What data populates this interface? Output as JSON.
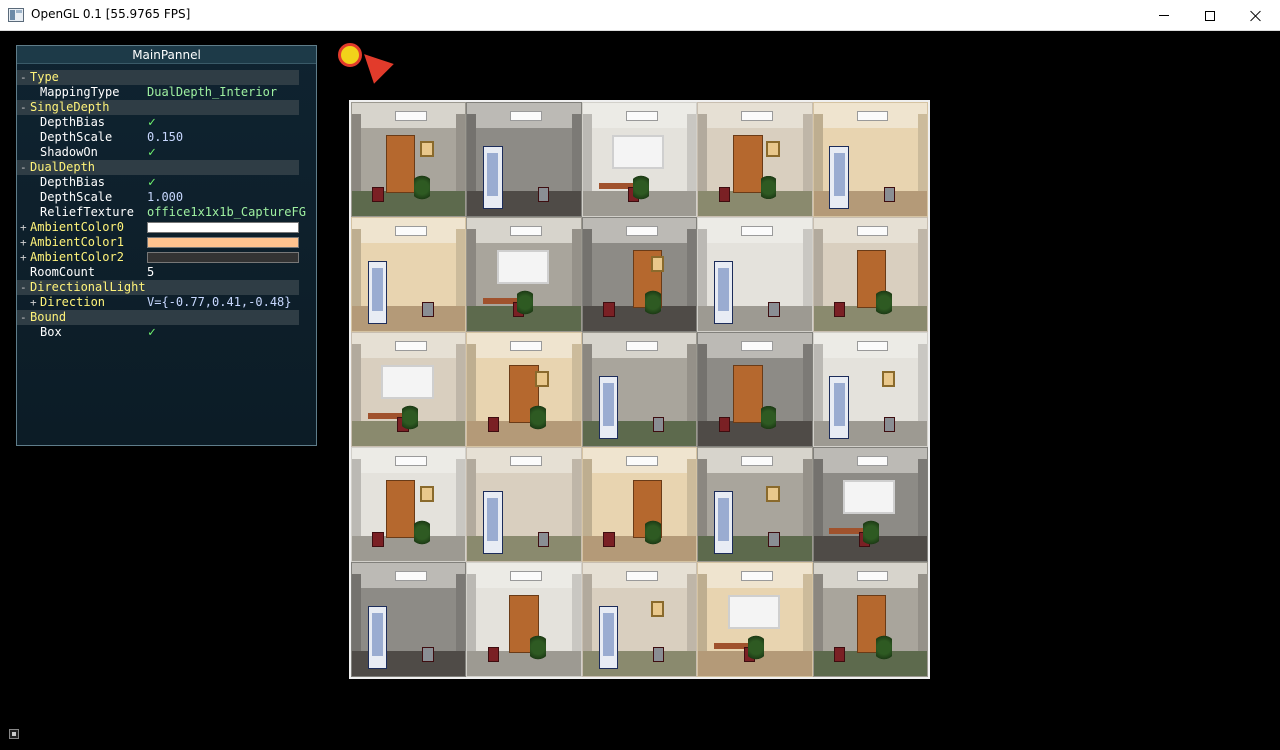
{
  "window": {
    "title": "OpenGL 0.1 [55.9765 FPS]",
    "buttons": [
      "minimize",
      "maximize",
      "close"
    ]
  },
  "panel": {
    "title": "MainPannel",
    "groups": {
      "type": {
        "label": "Type",
        "toggle": "-",
        "mapping_type_label": "MappingType",
        "mapping_type_value": "DualDepth_Interior"
      },
      "single_depth": {
        "label": "SingleDepth",
        "toggle": "-",
        "depth_bias_label": "DepthBias",
        "depth_bias_checked": true,
        "depth_scale_label": "DepthScale",
        "depth_scale_value": "0.150",
        "shadow_on_label": "ShadowOn",
        "shadow_on_checked": true
      },
      "dual_depth": {
        "label": "DualDepth",
        "toggle": "-",
        "depth_bias_label": "DepthBias",
        "depth_bias_checked": true,
        "depth_scale_label": "DepthScale",
        "depth_scale_value": "1.000",
        "relief_texture_label": "ReliefTexture",
        "relief_texture_value": "office1x1x1b_CaptureFG"
      },
      "ambient0": {
        "label": "AmbientColor0",
        "toggle": "+",
        "color": "#ffffff"
      },
      "ambient1": {
        "label": "AmbientColor1",
        "toggle": "+",
        "color": "#ffc38f"
      },
      "ambient2": {
        "label": "AmbientColor2",
        "toggle": "+",
        "color": "#333333"
      },
      "room_count": {
        "label": "RoomCount",
        "value": "5"
      },
      "directional_light": {
        "label": "DirectionalLight",
        "toggle": "-",
        "direction_label": "Direction",
        "direction_toggle": "+",
        "direction_value": "V={-0.77,0.41,-0.48}"
      },
      "bound": {
        "label": "Bound",
        "toggle": "-",
        "box_label": "Box",
        "box_checked": true
      }
    },
    "check_glyph": "✓"
  },
  "scene": {
    "light_icon": "sun-icon",
    "light_arrow": "light-direction-arrow-icon",
    "grid_rows": 5,
    "grid_cols": 5
  },
  "status": {
    "icon": "status-icon"
  },
  "colors": {
    "panel_bg": "#0f2330",
    "group_bg": "#2f3d45",
    "group_text": "#fff37a",
    "value_text": "#c8d8ff",
    "string_text": "#9ef0a0",
    "check": "#6ff36f"
  }
}
